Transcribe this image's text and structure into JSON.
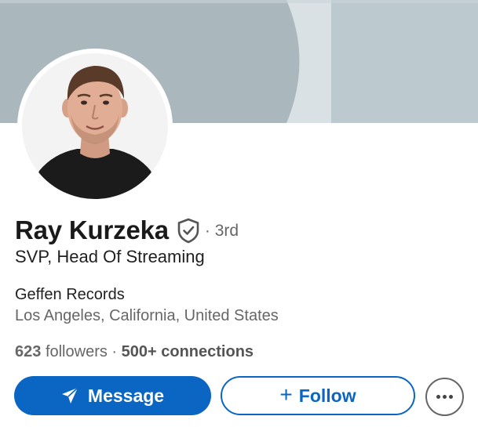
{
  "profile": {
    "name": "Ray Kurzeka",
    "connection_degree": "· 3rd",
    "headline": "SVP, Head Of Streaming",
    "company": "Geffen Records",
    "location": "Los Angeles, California, United States",
    "followers_count": "623",
    "followers_label": "followers",
    "stats_separator": " · ",
    "connections": "500+ connections"
  },
  "actions": {
    "message_label": "Message",
    "follow_symbol": "+",
    "follow_label": "Follow",
    "more_icon": "more-horizontal-icon",
    "message_icon": "paper-plane-icon"
  },
  "icons": {
    "verified": "verified-shield-icon"
  },
  "colors": {
    "accent": "#0a66c2",
    "banner": "#aab7bd",
    "text_primary": "#1f1f1f",
    "text_secondary": "#666666"
  }
}
